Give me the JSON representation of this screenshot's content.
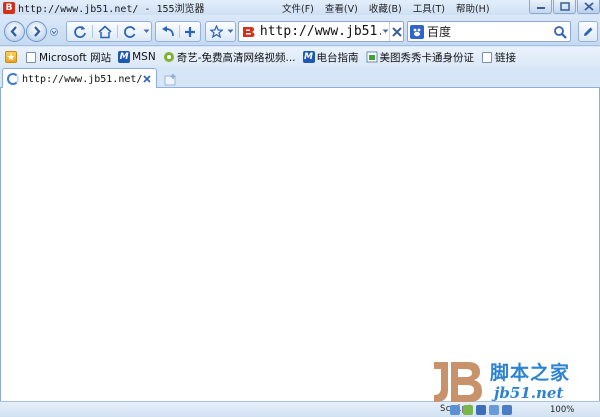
{
  "window": {
    "title": "http://www.jb51.net/ - 155浏览器",
    "logo_letter": "B"
  },
  "menu": {
    "items": [
      "文件(F)",
      "查看(V)",
      "收藏(B)",
      "工具(T)",
      "帮助(H)"
    ]
  },
  "toolbar": {
    "address_value": "http://www.jb51.net/",
    "search_value": "百度"
  },
  "bookmarks": {
    "items": [
      {
        "label": "Microsoft 网站",
        "icon": "page-icon"
      },
      {
        "label": "MSN",
        "icon": "msn-icon"
      },
      {
        "label": "奇艺-免费高清网络视频...",
        "icon": "qiyi-icon"
      },
      {
        "label": "电台指南",
        "icon": "msn-icon"
      },
      {
        "label": "美图秀秀卡通身份证",
        "icon": "meitu-icon"
      },
      {
        "label": "链接",
        "icon": "page-icon"
      }
    ]
  },
  "tabs": [
    {
      "title": "http://www.jb51.net/"
    }
  ],
  "status": {
    "script_label": "Script",
    "zoom": "100%"
  },
  "watermark": {
    "logo_text": "JB",
    "cn": "脚本之家",
    "en": "jb51.net"
  },
  "colors": {
    "chrome": "#d6e6f7",
    "accent": "#2d83d2",
    "logo_red": "#d62f1c"
  }
}
